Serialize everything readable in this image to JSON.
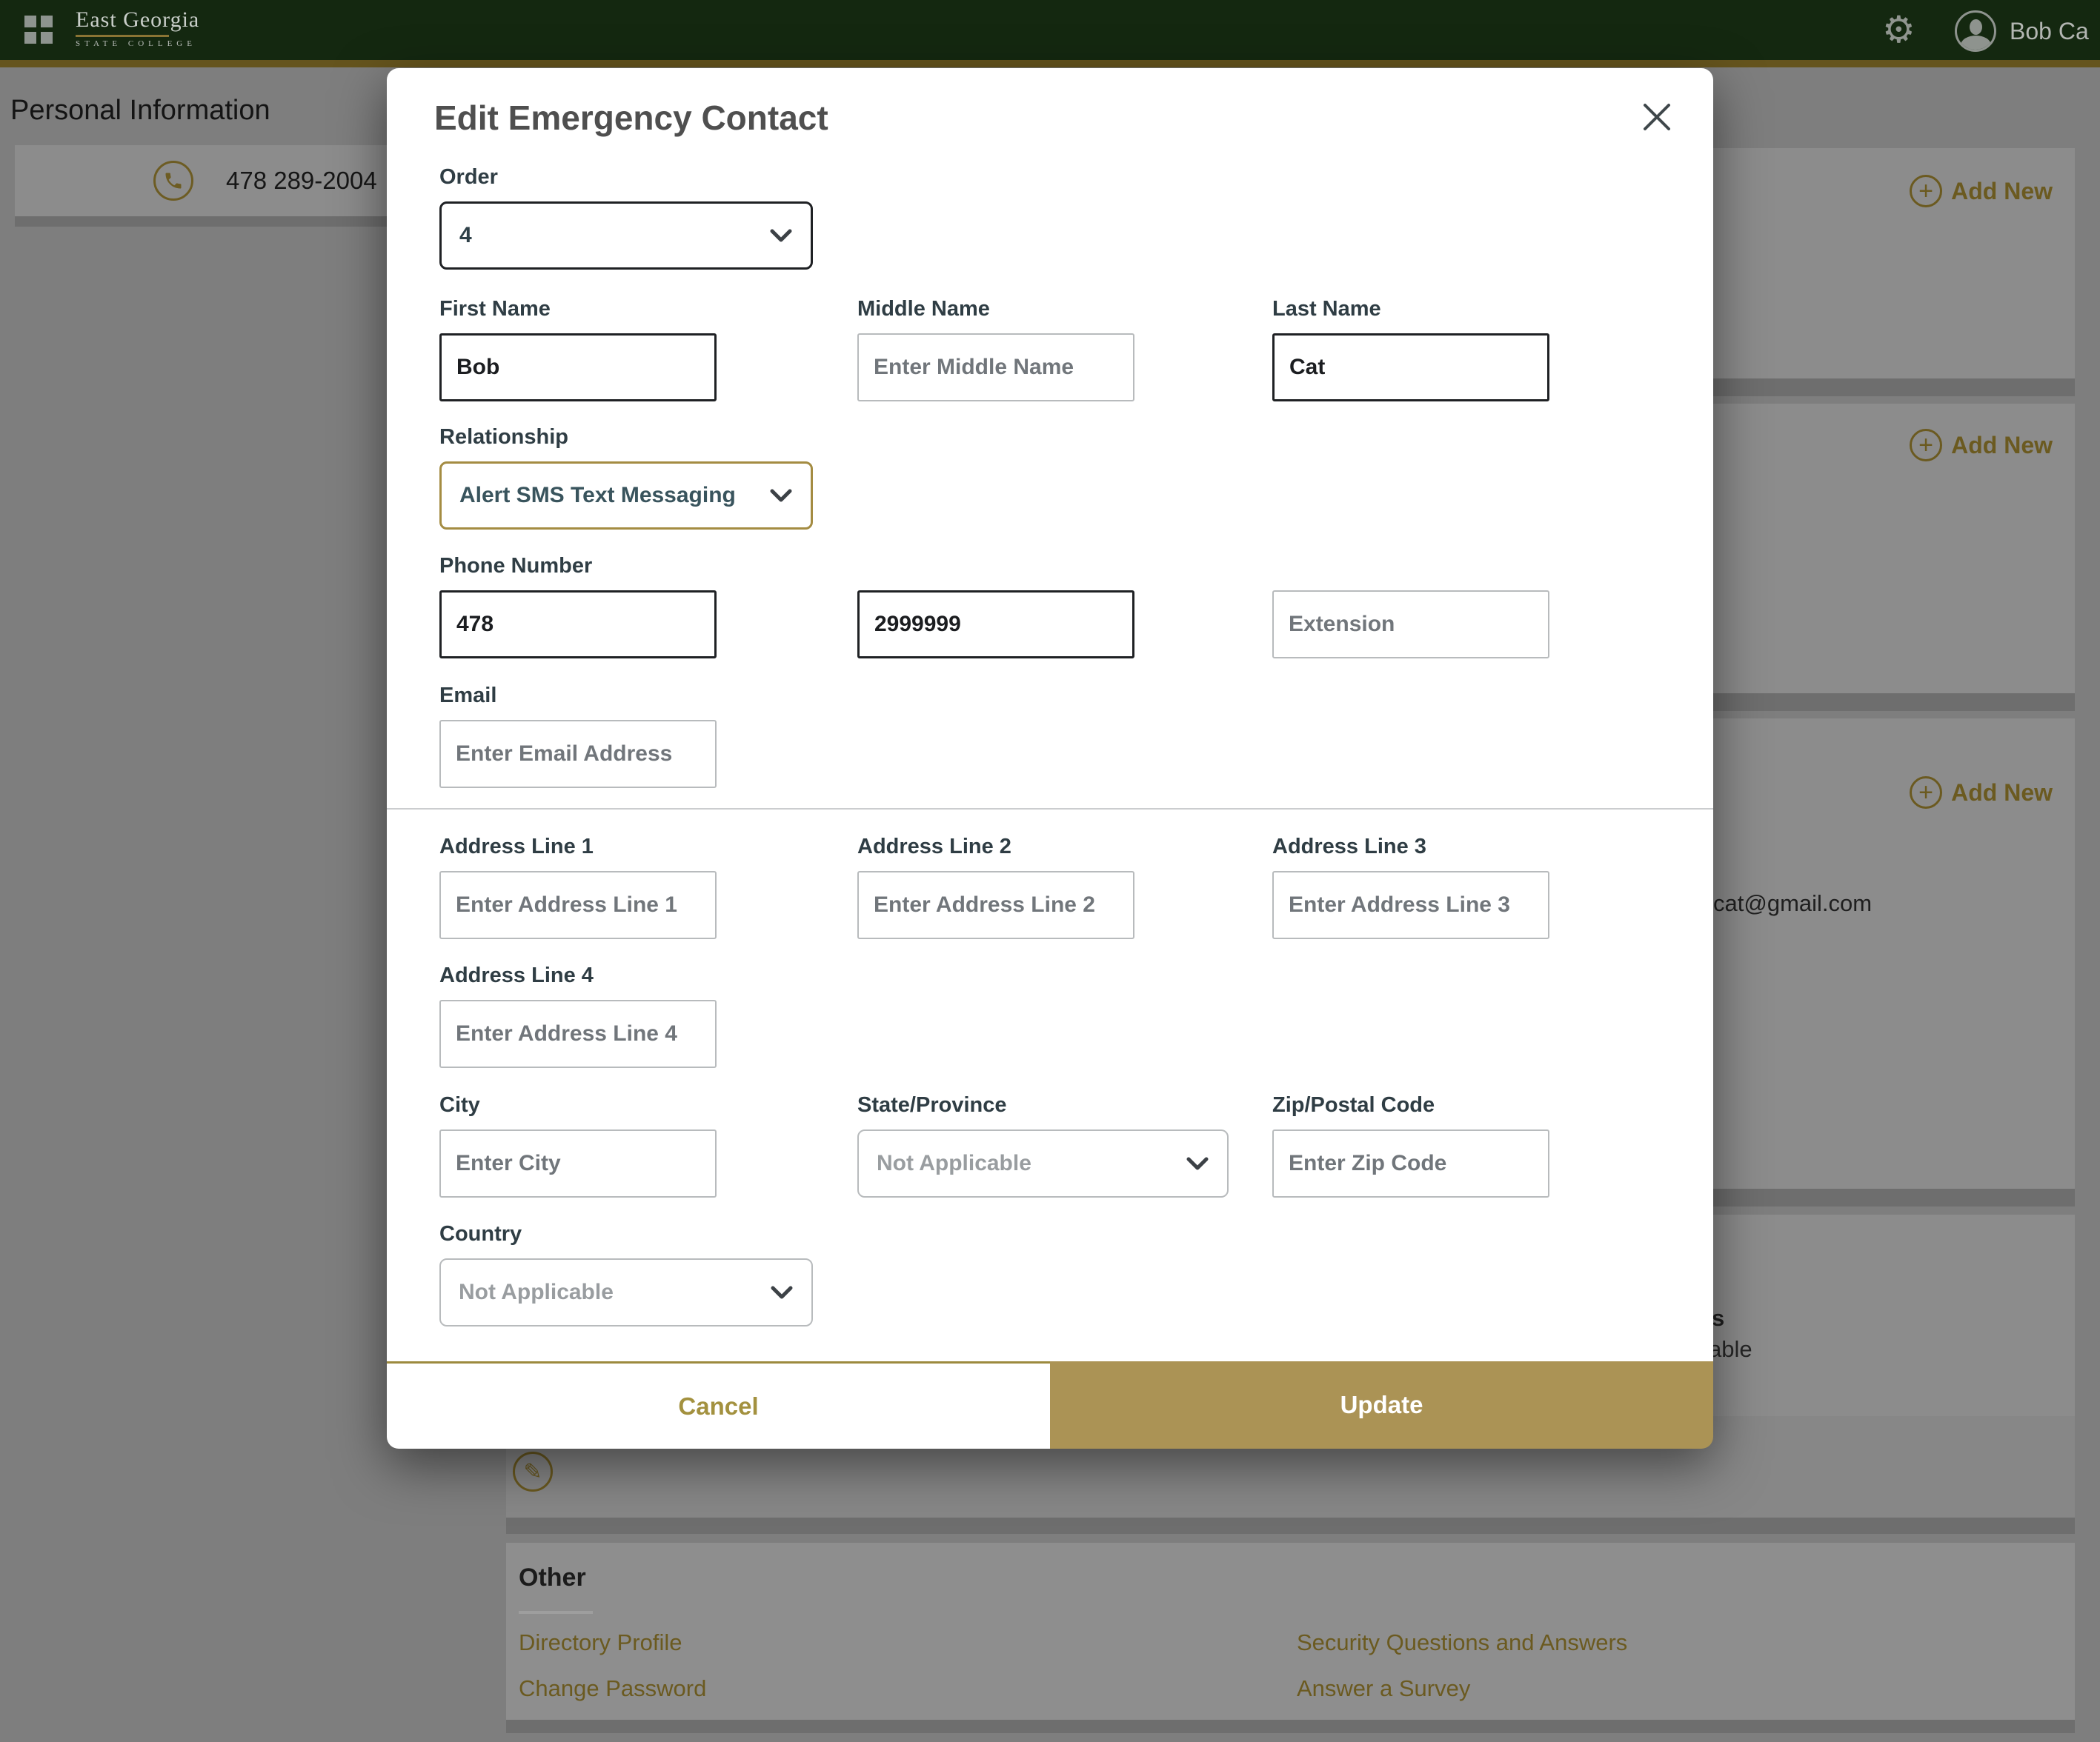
{
  "header": {
    "logo_title": "East Georgia",
    "logo_subtitle": "STATE COLLEGE",
    "user_name": "Bob Ca"
  },
  "page": {
    "title": "Personal Information",
    "phone_number": "478 289-2004",
    "add_new_label": "Add New",
    "email_fragment": "cat@gmail.com",
    "text_fragment_1": "s",
    "text_fragment_2": "able",
    "other_section": {
      "heading": "Other",
      "links": {
        "directory_profile": "Directory Profile",
        "change_password": "Change Password",
        "security_questions": "Security Questions and Answers",
        "answer_survey": "Answer a Survey"
      }
    }
  },
  "modal": {
    "title": "Edit Emergency Contact",
    "order": {
      "label": "Order",
      "value": "4"
    },
    "first_name": {
      "label": "First Name",
      "value": "Bob"
    },
    "middle_name": {
      "label": "Middle Name",
      "placeholder": "Enter Middle Name"
    },
    "last_name": {
      "label": "Last Name",
      "value": "Cat"
    },
    "relationship": {
      "label": "Relationship",
      "value": "Alert SMS Text Messaging"
    },
    "phone": {
      "label": "Phone Number",
      "area_code": "478",
      "number": "2999999",
      "extension_placeholder": "Extension"
    },
    "email": {
      "label": "Email",
      "placeholder": "Enter Email Address"
    },
    "address_line_1": {
      "label": "Address Line 1",
      "placeholder": "Enter Address Line 1"
    },
    "address_line_2": {
      "label": "Address Line 2",
      "placeholder": "Enter Address Line 2"
    },
    "address_line_3": {
      "label": "Address Line 3",
      "placeholder": "Enter Address Line 3"
    },
    "address_line_4": {
      "label": "Address Line 4",
      "placeholder": "Enter Address Line 4"
    },
    "city": {
      "label": "City",
      "placeholder": "Enter City"
    },
    "state": {
      "label": "State/Province",
      "value": "Not Applicable"
    },
    "zip": {
      "label": "Zip/Postal Code",
      "placeholder": "Enter Zip Code"
    },
    "country": {
      "label": "Country",
      "value": "Not Applicable"
    },
    "cancel_label": "Cancel",
    "update_label": "Update"
  },
  "colors": {
    "header_green": "#142810",
    "accent_gold": "#a3913f",
    "update_button_gold": "#ab9355",
    "relationship_border_gold": "#a48c42",
    "filled_border": "#1f2124",
    "empty_border": "#b8bbbd",
    "placeholder_text": "#71767b",
    "select_text_teal": "#39545d"
  }
}
